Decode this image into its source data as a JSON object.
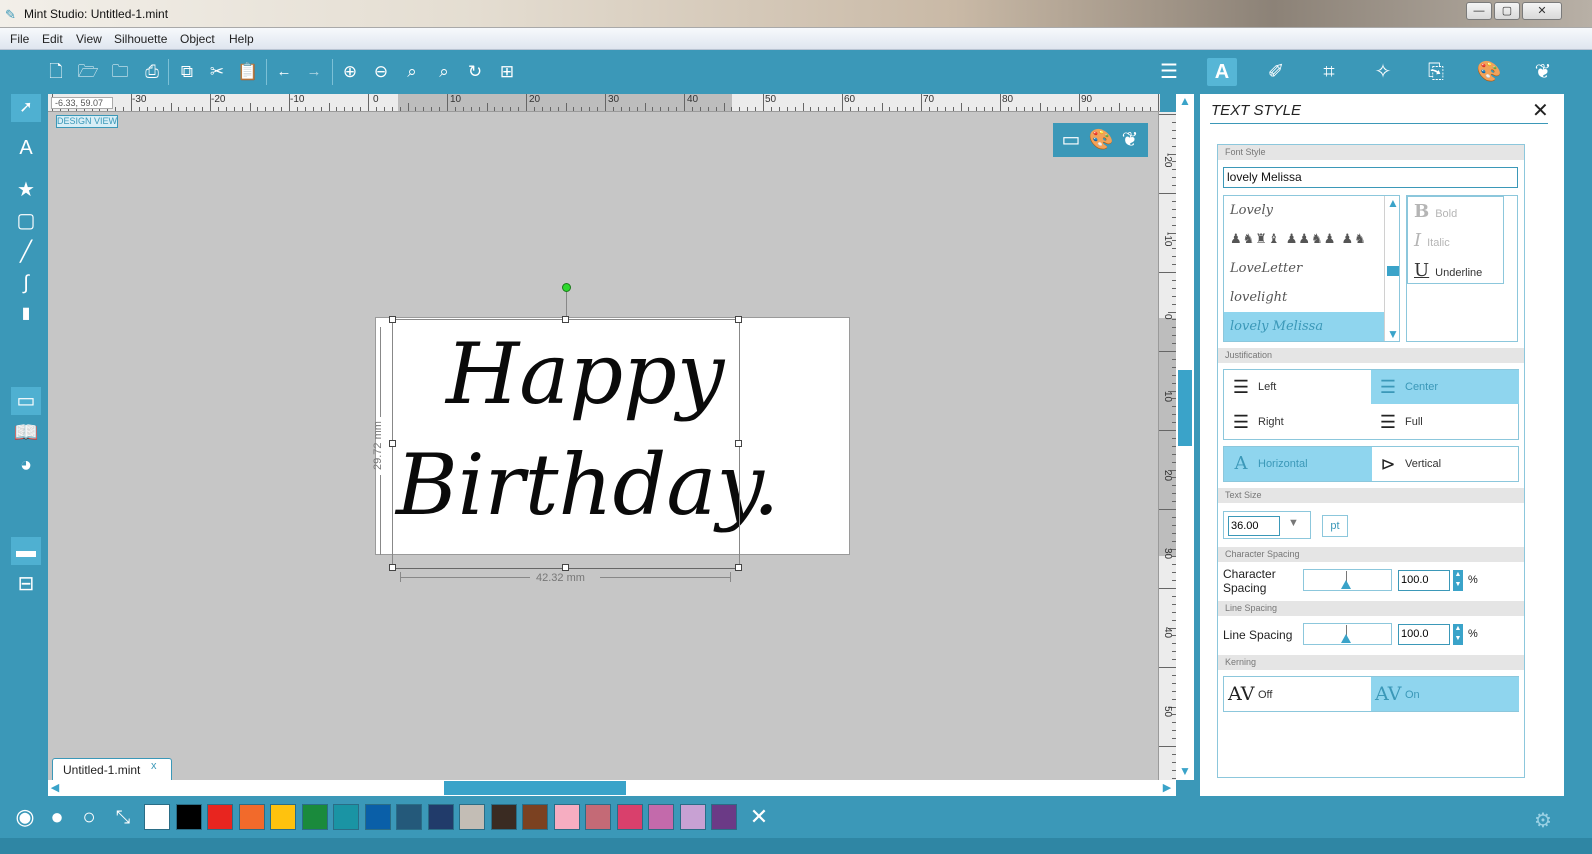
{
  "window": {
    "title": "Mint Studio: Untitled-1.mint"
  },
  "menu": [
    "File",
    "Edit",
    "View",
    "Silhouette",
    "Object",
    "Help"
  ],
  "ruler": {
    "coords": "-6.33, 59.07",
    "h_labels": [
      "-30",
      "-20",
      "-10",
      "0",
      "10",
      "20",
      "30",
      "40",
      "50",
      "60",
      "70",
      "80",
      "90"
    ],
    "v_labels": [
      "-20",
      "-10",
      "0",
      "10",
      "20",
      "30",
      "40",
      "50"
    ]
  },
  "canvas": {
    "design_view_label": "DESIGN VIEW",
    "text_lines": [
      "Happy",
      "Birthday."
    ],
    "width_dim": "42.32 mm",
    "height_dim": "29.72 mm"
  },
  "doc_tab": {
    "name": "Untitled-1.mint",
    "close": "x"
  },
  "panel": {
    "title": "TEXT STYLE",
    "font_style": {
      "header": "Font Style",
      "value": "lovely Melissa",
      "fonts": [
        "Lovely",
        "Lovely Silhouettes",
        "LoveLetter",
        "lovelight",
        "lovely Melissa"
      ],
      "selected_index": 4
    },
    "styles": {
      "bold": "Bold",
      "italic": "Italic",
      "underline": "Underline"
    },
    "justification": {
      "header": "Justification",
      "left": "Left",
      "center": "Center",
      "right": "Right",
      "full": "Full",
      "selected": "center"
    },
    "orientation": {
      "horizontal": "Horizontal",
      "vertical": "Vertical",
      "selected": "horizontal"
    },
    "text_size": {
      "header": "Text Size",
      "value": "36.00",
      "unit": "pt"
    },
    "char_spacing": {
      "header": "Character Spacing",
      "label_line1": "Character",
      "label_line2": "Spacing",
      "value": "100.0",
      "unit": "%"
    },
    "line_spacing": {
      "header": "Line Spacing",
      "label": "Line Spacing",
      "value": "100.0",
      "unit": "%"
    },
    "kerning": {
      "header": "Kerning",
      "off": "Off",
      "on": "On",
      "selected": "on"
    }
  },
  "palette": {
    "swatches": [
      "#ffffff",
      "#000000",
      "#e8251f",
      "#f26a2b",
      "#ffc20e",
      "#1a8a3c",
      "#1a94a4",
      "#0a5fa8",
      "#24597a",
      "#213b6a",
      "#c3bdb5",
      "#3a2b22",
      "#7b4121",
      "#f6adc1",
      "#c46a76",
      "#d9406c",
      "#c36aab",
      "#c8a1d3",
      "#6b3a86"
    ]
  },
  "icons": {
    "toolbar_left": [
      "new-file-icon",
      "open-folder-icon",
      "open-recent-icon",
      "print-icon",
      "copy-icon",
      "cut-icon",
      "paste-icon",
      "undo-icon",
      "redo-icon",
      "zoom-in-icon",
      "zoom-out-icon",
      "zoom-selected-icon",
      "zoom-fit-icon",
      "zoom-refresh-icon",
      "fit-page-icon"
    ],
    "toolbar_right": [
      "page-setup-icon",
      "text-style-icon",
      "line-style-icon",
      "transform-icon",
      "trace-icon",
      "send-icon",
      "fill-color-icon",
      "lightning-icon"
    ]
  }
}
